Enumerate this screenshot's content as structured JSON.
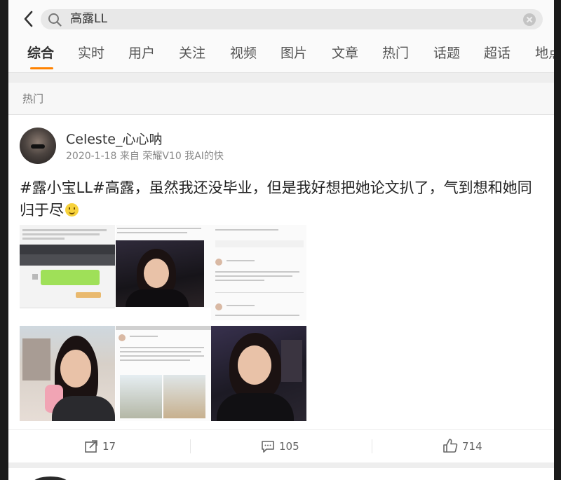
{
  "search": {
    "query": "高露LL"
  },
  "tabs": [
    "综合",
    "实时",
    "用户",
    "关注",
    "视频",
    "图片",
    "文章",
    "热门",
    "话题",
    "超话",
    "地点"
  ],
  "section": {
    "title": "热门"
  },
  "post": {
    "username": "Celeste_心心呐",
    "meta": "2020-1-18 来自 荣耀V10 我AI的快",
    "text": "#露小宝LL#高露，虽然我还没毕业，但是我好想把她论文扒了，气到想和她同归于尽",
    "images": [
      "chat-screenshot",
      "night-selfie-car",
      "weibo-post-screenshot",
      "portrait-selfie",
      "weibo-repost-screenshot",
      "night-selfie-car-2"
    ],
    "actions": {
      "repost": "17",
      "comment": "105",
      "like": "714"
    }
  },
  "colors": {
    "accent": "#ff8200"
  }
}
